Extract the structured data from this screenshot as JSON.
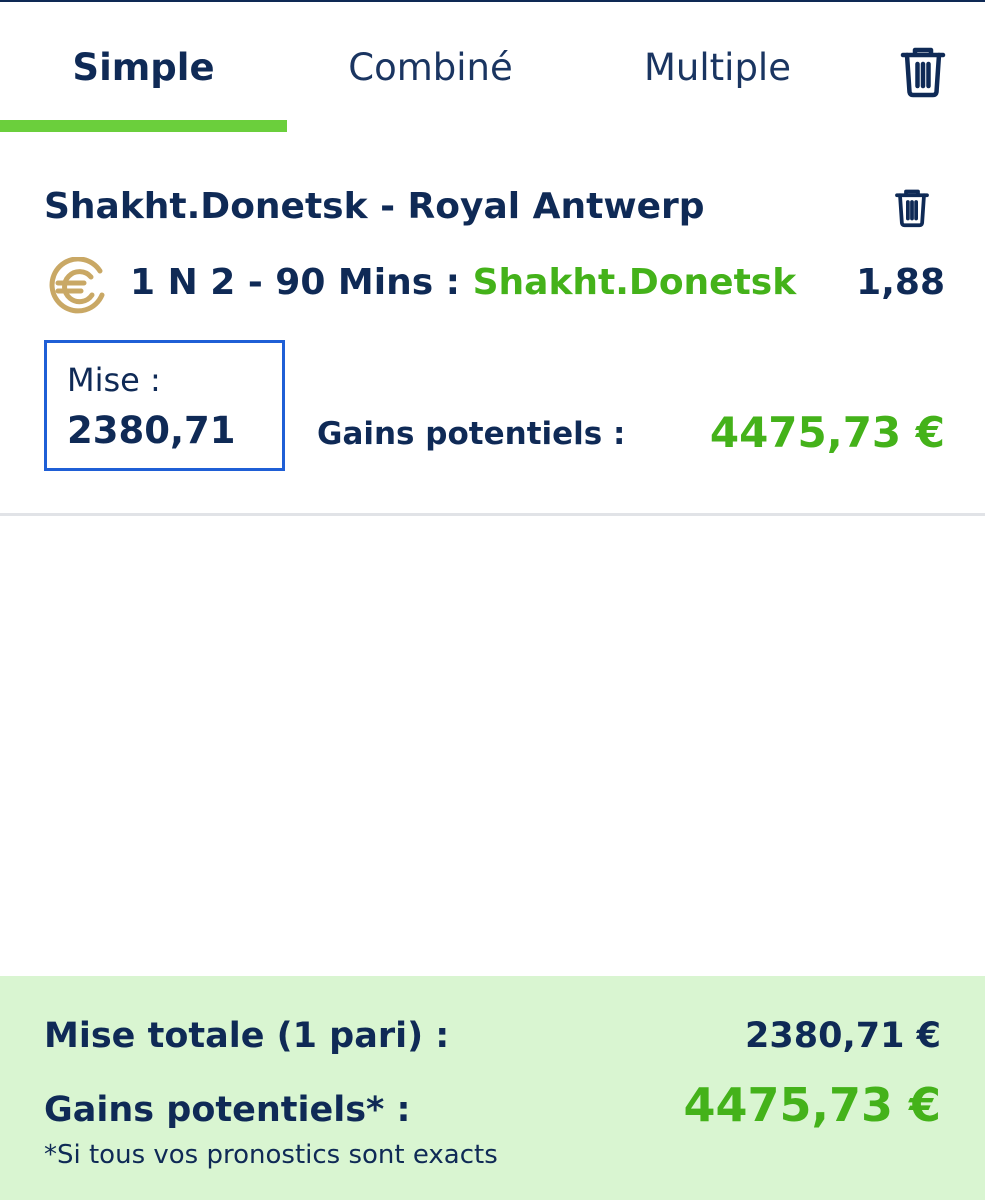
{
  "tabs": [
    {
      "label": "Simple",
      "active": true
    },
    {
      "label": "Combiné",
      "active": false
    },
    {
      "label": "Multiple",
      "active": false
    }
  ],
  "colors": {
    "navy": "#0f2a56",
    "green": "#44b21a",
    "indicator": "#6bcf3c",
    "input_border": "#1f5fd6",
    "summary_bg": "#d9f5d1",
    "coin": "#c9a865"
  },
  "bet": {
    "match": "Shakht.Donetsk - Royal Antwerp",
    "market": "1 N 2 - 90 Mins : ",
    "pick": "Shakht.Donetsk",
    "odds": "1,88",
    "stake_label": "Mise :",
    "stake_value": "2380,71",
    "gains_label": "Gains potentiels :",
    "gains_value": "4475,73 €",
    "icon": "euro-coin-icon"
  },
  "summary": {
    "total_label": "Mise totale (1 pari) :",
    "total_value": "2380,71 €",
    "gains_label": "Gains potentiels* :",
    "gains_value": "4475,73 €",
    "footnote": "*Si tous vos pronostics sont exacts"
  }
}
